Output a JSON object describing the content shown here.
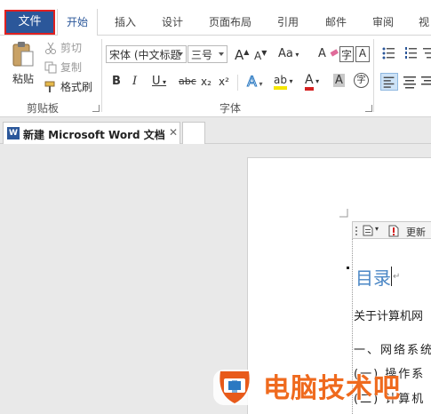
{
  "ribbon_tabs": {
    "file": "文件",
    "home": "开始",
    "insert": "插入",
    "design": "设计",
    "layout": "页面布局",
    "references": "引用",
    "mailings": "邮件",
    "review": "审阅",
    "view": "视"
  },
  "clipboard": {
    "paste": "粘贴",
    "cut": "剪切",
    "copy": "复制",
    "format_painter": "格式刷",
    "group_label": "剪贴板"
  },
  "font": {
    "font_name": "宋体 (中文标题",
    "font_size": "三号",
    "grow": "A",
    "shrink": "A",
    "change_case": "Aa",
    "clear_format": "A",
    "bold": "B",
    "italic": "I",
    "underline": "U",
    "strikethrough": "abc",
    "subscript": "x₂",
    "superscript": "x²",
    "text_effects": "A",
    "highlight": "ab",
    "font_color": "A",
    "char_shading": "A",
    "enclose": "字",
    "group_label": "字体"
  },
  "document_tab": {
    "name": "新建 Microsoft Word 文档",
    "icon_letter": "W",
    "close": "✕"
  },
  "toc": {
    "update_label": "更新",
    "title": "目录",
    "para_mark": "↵"
  },
  "body": {
    "line1": "关于计算机网",
    "line2": "一、网络系统",
    "line3": "(一) 操作系",
    "line4": "(二) 计算机"
  },
  "watermark": {
    "text": "电脑技术吧"
  },
  "colors": {
    "file_tab_bg": "#2b579a",
    "file_tab_outline": "#e02020",
    "toc_title": "#4a86c5",
    "watermark": "#ef6a1e",
    "highlight": "#f5e600",
    "font_color": "#d42020"
  }
}
